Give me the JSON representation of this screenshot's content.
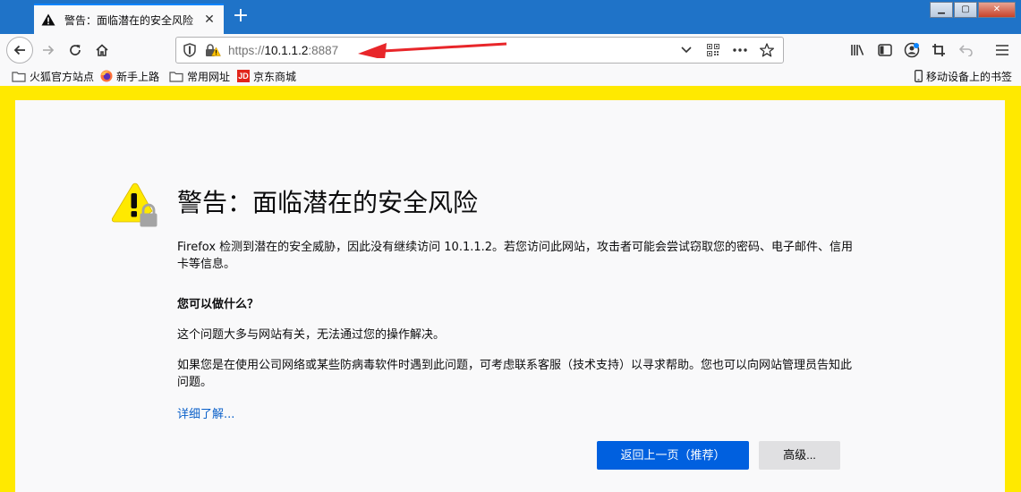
{
  "tab": {
    "title": "警告：面临潜在的安全风险",
    "close": "✕",
    "new_tab": "+"
  },
  "window": {
    "minimize": "▁",
    "maximize": "▢",
    "close": "✕"
  },
  "url": {
    "scheme": "https://",
    "host": "10.1.1.2",
    "port": ":8887"
  },
  "bookmarks": [
    {
      "label": "火狐官方站点",
      "icon": "folder-icon"
    },
    {
      "label": "新手上路",
      "icon": "firefox-icon"
    },
    {
      "label": "常用网址",
      "icon": "folder-icon"
    },
    {
      "label": "京东商城",
      "icon": "jd-icon",
      "icon_text": "JD"
    }
  ],
  "mobile_bookmarks": "移动设备上的书签",
  "error": {
    "heading": "警告：面临潜在的安全风险",
    "description": "Firefox 检测到潜在的安全威胁，因此没有继续访问 10.1.1.2。若您访问此网站，攻击者可能会尝试窃取您的密码、电子邮件、信用卡等信息。",
    "question": "您可以做什么？",
    "answer1": "这个问题大多与网站有关，无法通过您的操作解决。",
    "answer2": "如果您是在使用公司网络或某些防病毒软件时遇到此问题，可考虑联系客服（技术支持）以寻求帮助。您也可以向网站管理员告知此问题。",
    "learn_more": "详细了解...",
    "go_back": "返回上一页（推荐）",
    "advanced": "高级..."
  },
  "colors": {
    "accent": "#0060df",
    "warning_border": "#ffe900",
    "tab_strip": "#1f73c8",
    "annotation_arrow": "#e8262a"
  }
}
